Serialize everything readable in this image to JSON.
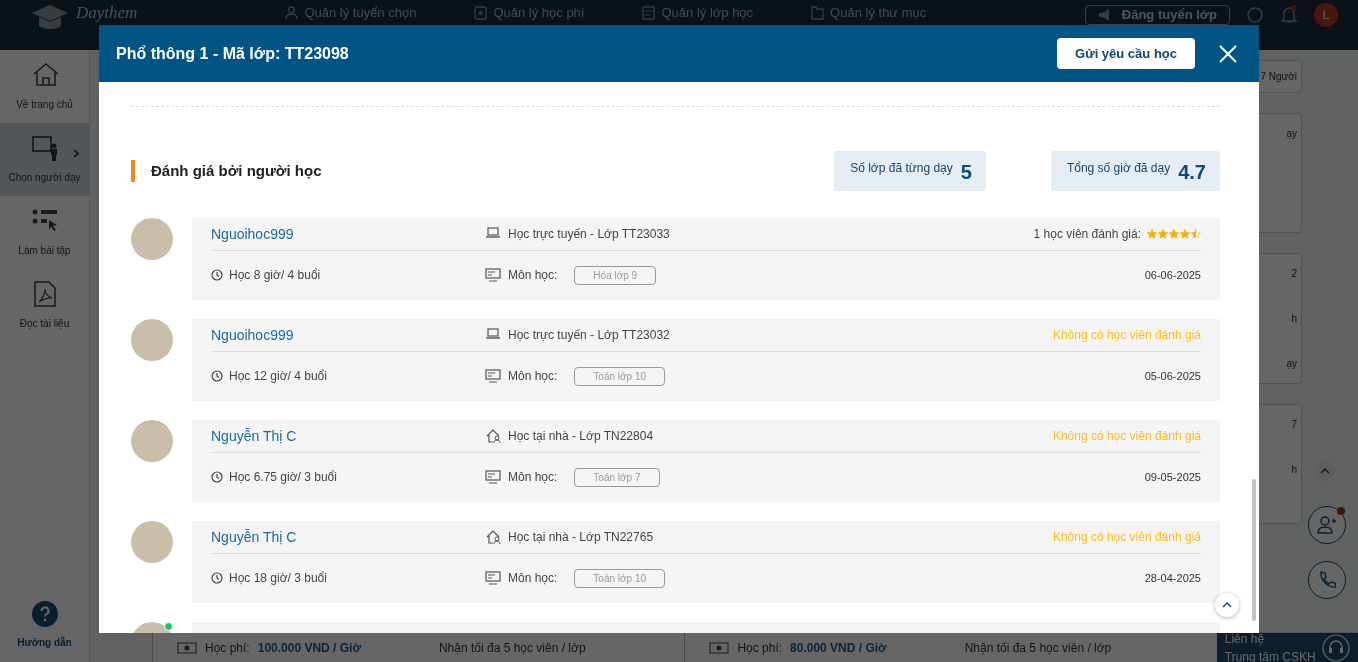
{
  "app": {
    "logo": "Daythem",
    "nav": [
      {
        "kind": "recruit",
        "label": "Quản lý tuyển chọn"
      },
      {
        "kind": "fee",
        "label": "Quản lý học phí"
      },
      {
        "kind": "class",
        "label": "Quản lý lớp học"
      },
      {
        "kind": "folder",
        "label": "Quản lý thư mục"
      }
    ],
    "post_button": "Đăng tuyển lớp",
    "avatar_initial": "L"
  },
  "sidebar": {
    "items": [
      {
        "kind": "home",
        "label": "Về trang chủ",
        "selected": false,
        "expandable": false
      },
      {
        "kind": "teacher",
        "label": "Chọn người dạy",
        "selected": true,
        "expandable": true
      },
      {
        "kind": "exercise",
        "label": "Làm bài tập",
        "selected": false,
        "expandable": false
      },
      {
        "kind": "pdf",
        "label": "Đọc tài liệu",
        "selected": false,
        "expandable": false
      }
    ],
    "help": "Hướng dẫn"
  },
  "background": {
    "right_cards": [
      [
        "7 Người"
      ],
      [
        "ạy"
      ],
      [
        "2",
        "h",
        "ạy"
      ],
      [
        "7",
        "h"
      ]
    ],
    "listings": [
      {
        "fee_label": "Học phí:",
        "fee": "100.000 VND / Giờ",
        "capacity": "Nhận tối đa 5 học viên / lớp"
      },
      {
        "fee_label": "Học phí:",
        "fee": "80.000 VND / Giờ",
        "capacity": "Nhận tối đa 5 học viên / lớp"
      }
    ],
    "support": {
      "line1": "Liên hệ",
      "line2": "Trung tâm CSKH"
    }
  },
  "modal": {
    "title": "Phổ thông 1 - Mã lớp: TT23098",
    "request_button": "Gửi yêu cầu học",
    "section_title": "Đánh giá bởi người học",
    "stats": [
      {
        "label": "Số lớp đã từng dạy",
        "value": "5"
      },
      {
        "label": "Tổng số giờ đã dạy",
        "value": "4.7"
      }
    ],
    "reviews": [
      {
        "name": "Nguoihoc999",
        "kind": "online",
        "class_text": "Học trực tuyến - Lớp TT23033",
        "hours": "Học 8 giờ/ 4 buổi",
        "subject_label": "Môn học:",
        "subject": "Hóa lớp 9",
        "rating": {
          "kind": "stars",
          "label": "1 học viên đánh giá:",
          "stars": 4.5
        },
        "date": "06-06-2025"
      },
      {
        "name": "Nguoihoc999",
        "kind": "online",
        "class_text": "Học trực tuyến - Lớp TT23032",
        "hours": "Học 12 giờ/ 4 buổi",
        "subject_label": "Môn học:",
        "subject": "Toán lớp 10",
        "rating": {
          "kind": "none",
          "label": "Không có học viên đánh giá"
        },
        "date": "05-06-2025"
      },
      {
        "name": "Nguyễn Thị C",
        "kind": "home",
        "class_text": "Học tại nhà - Lớp TN22804",
        "hours": "Học 6.75 giờ/ 3 buổi",
        "subject_label": "Môn học:",
        "subject": "Toán lớp 7",
        "rating": {
          "kind": "none",
          "label": "Không có học viên đánh giá"
        },
        "date": "09-05-2025"
      },
      {
        "name": "Nguyễn Thị C",
        "kind": "home",
        "class_text": "Học tại nhà - Lớp TN22765",
        "hours": "Học 18 giờ/ 3 buổi",
        "subject_label": "Môn học:",
        "subject": "Toán lớp 10",
        "rating": {
          "kind": "none",
          "label": "Không có học viên đánh giá"
        },
        "date": "28-04-2025"
      }
    ],
    "next_review": {
      "online": true
    }
  }
}
